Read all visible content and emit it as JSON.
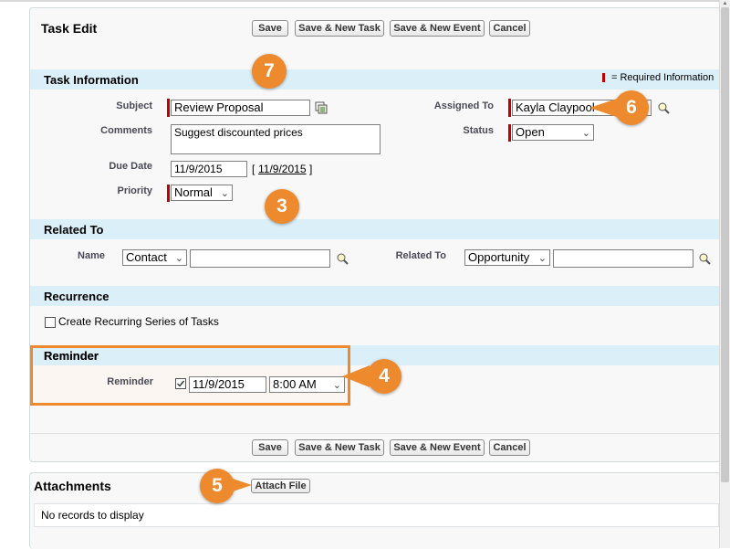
{
  "header": {
    "title": "Task Edit"
  },
  "buttons": {
    "save": "Save",
    "save_new_task": "Save & New Task",
    "save_new_event": "Save & New Event",
    "cancel": "Cancel"
  },
  "task_info": {
    "section_title": "Task Information",
    "required_note": "= Required Information",
    "subject_label": "Subject",
    "subject_value": "Review Proposal",
    "comments_label": "Comments",
    "comments_value": "Suggest discounted prices",
    "due_date_label": "Due Date",
    "due_date_value": "11/9/2015",
    "due_date_link": "11/9/2015",
    "bracket_open": "[",
    "bracket_close": "]",
    "priority_label": "Priority",
    "priority_value": "Normal",
    "assigned_label": "Assigned To",
    "assigned_value": "Kayla Claypool",
    "status_label": "Status",
    "status_value": "Open"
  },
  "related": {
    "section_title": "Related To",
    "name_label": "Name",
    "name_type": "Contact",
    "name_value": "",
    "related_label": "Related To",
    "related_type": "Opportunity",
    "related_value": ""
  },
  "recurrence": {
    "section_title": "Recurrence",
    "checkbox_label": "Create Recurring Series of Tasks"
  },
  "reminder": {
    "section_title": "Reminder",
    "label": "Reminder",
    "date": "11/9/2015",
    "time": "8:00 AM"
  },
  "attachments": {
    "title": "Attachments",
    "attach_button": "Attach File",
    "empty_text": "No records to display"
  },
  "callouts": {
    "c7": "7",
    "c6": "6",
    "c3": "3",
    "c4": "4",
    "c5": "5"
  },
  "icons": {
    "lookup": "lookup-magnifier-icon",
    "combo": "combo-picker-icon",
    "chevron": "chevron-down-icon"
  },
  "colors": {
    "section_bg": "#dbeff8",
    "required": "#c00000",
    "callout": "#ed8a2e",
    "highlight_border": "#ed8a2e"
  }
}
